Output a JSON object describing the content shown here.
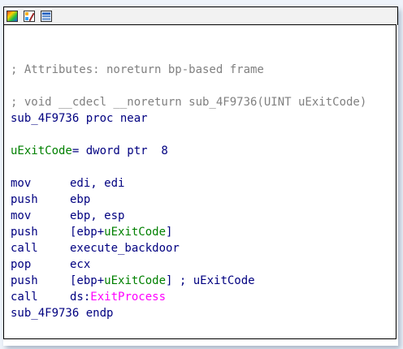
{
  "toolbar": {
    "icons": [
      "graph-colors-icon",
      "edit-palette-icon",
      "graph-view-icon"
    ]
  },
  "colors": {
    "code": "#000080",
    "comment": "#808080",
    "local_var": "#008000",
    "import": "#ff00ff",
    "border": "#000000"
  },
  "listing": {
    "attributes_comment": "; Attributes: noreturn bp-based frame",
    "prototype_comment": "; void __cdecl __noreturn sub_4F9736(UINT uExitCode)",
    "proc_name": "sub_4F9736",
    "proc_keyword": "proc near",
    "var_name": "uExitCode",
    "var_def": "= dword ptr  8",
    "instructions": [
      {
        "mnemonic": "mov",
        "pre": "edi, edi",
        "ref": "",
        "post": ""
      },
      {
        "mnemonic": "push",
        "pre": "ebp",
        "ref": "",
        "post": ""
      },
      {
        "mnemonic": "mov",
        "pre": "ebp, esp",
        "ref": "",
        "post": ""
      },
      {
        "mnemonic": "push",
        "pre": "[ebp+",
        "ref": "uExitCode",
        "post": "]"
      },
      {
        "mnemonic": "call",
        "pre": "execute_backdoor",
        "ref": "",
        "post": ""
      },
      {
        "mnemonic": "pop",
        "pre": "ecx",
        "ref": "",
        "post": ""
      },
      {
        "mnemonic": "push",
        "pre": "[ebp+",
        "ref": "uExitCode",
        "post": "] ; uExitCode"
      },
      {
        "mnemonic": "call",
        "pre": "ds:",
        "ref": "ExitProcess",
        "post": ""
      }
    ],
    "endp_name": "sub_4F9736",
    "endp_keyword": "endp"
  }
}
